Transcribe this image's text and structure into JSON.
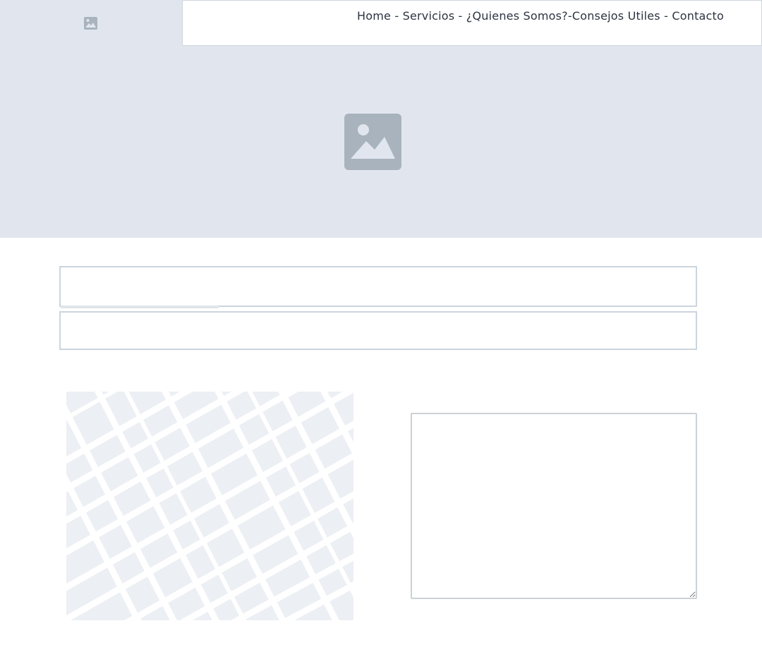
{
  "header": {
    "logo_icon": "image-placeholder-icon",
    "nav_text": "Home - Servicios - ¿Quienes Somos?-Consejos Utiles - Contacto"
  },
  "hero": {
    "icon": "image-placeholder-icon"
  },
  "form": {
    "field_1_value": "",
    "field_2_value": "",
    "message_value": ""
  },
  "map": {
    "icon": "map-placeholder"
  },
  "colors": {
    "placeholder_bg": "#e1e6ee",
    "placeholder_icon": "#a8b3bd",
    "nav_text": "#2b3440",
    "border": "#ccd5dd"
  }
}
